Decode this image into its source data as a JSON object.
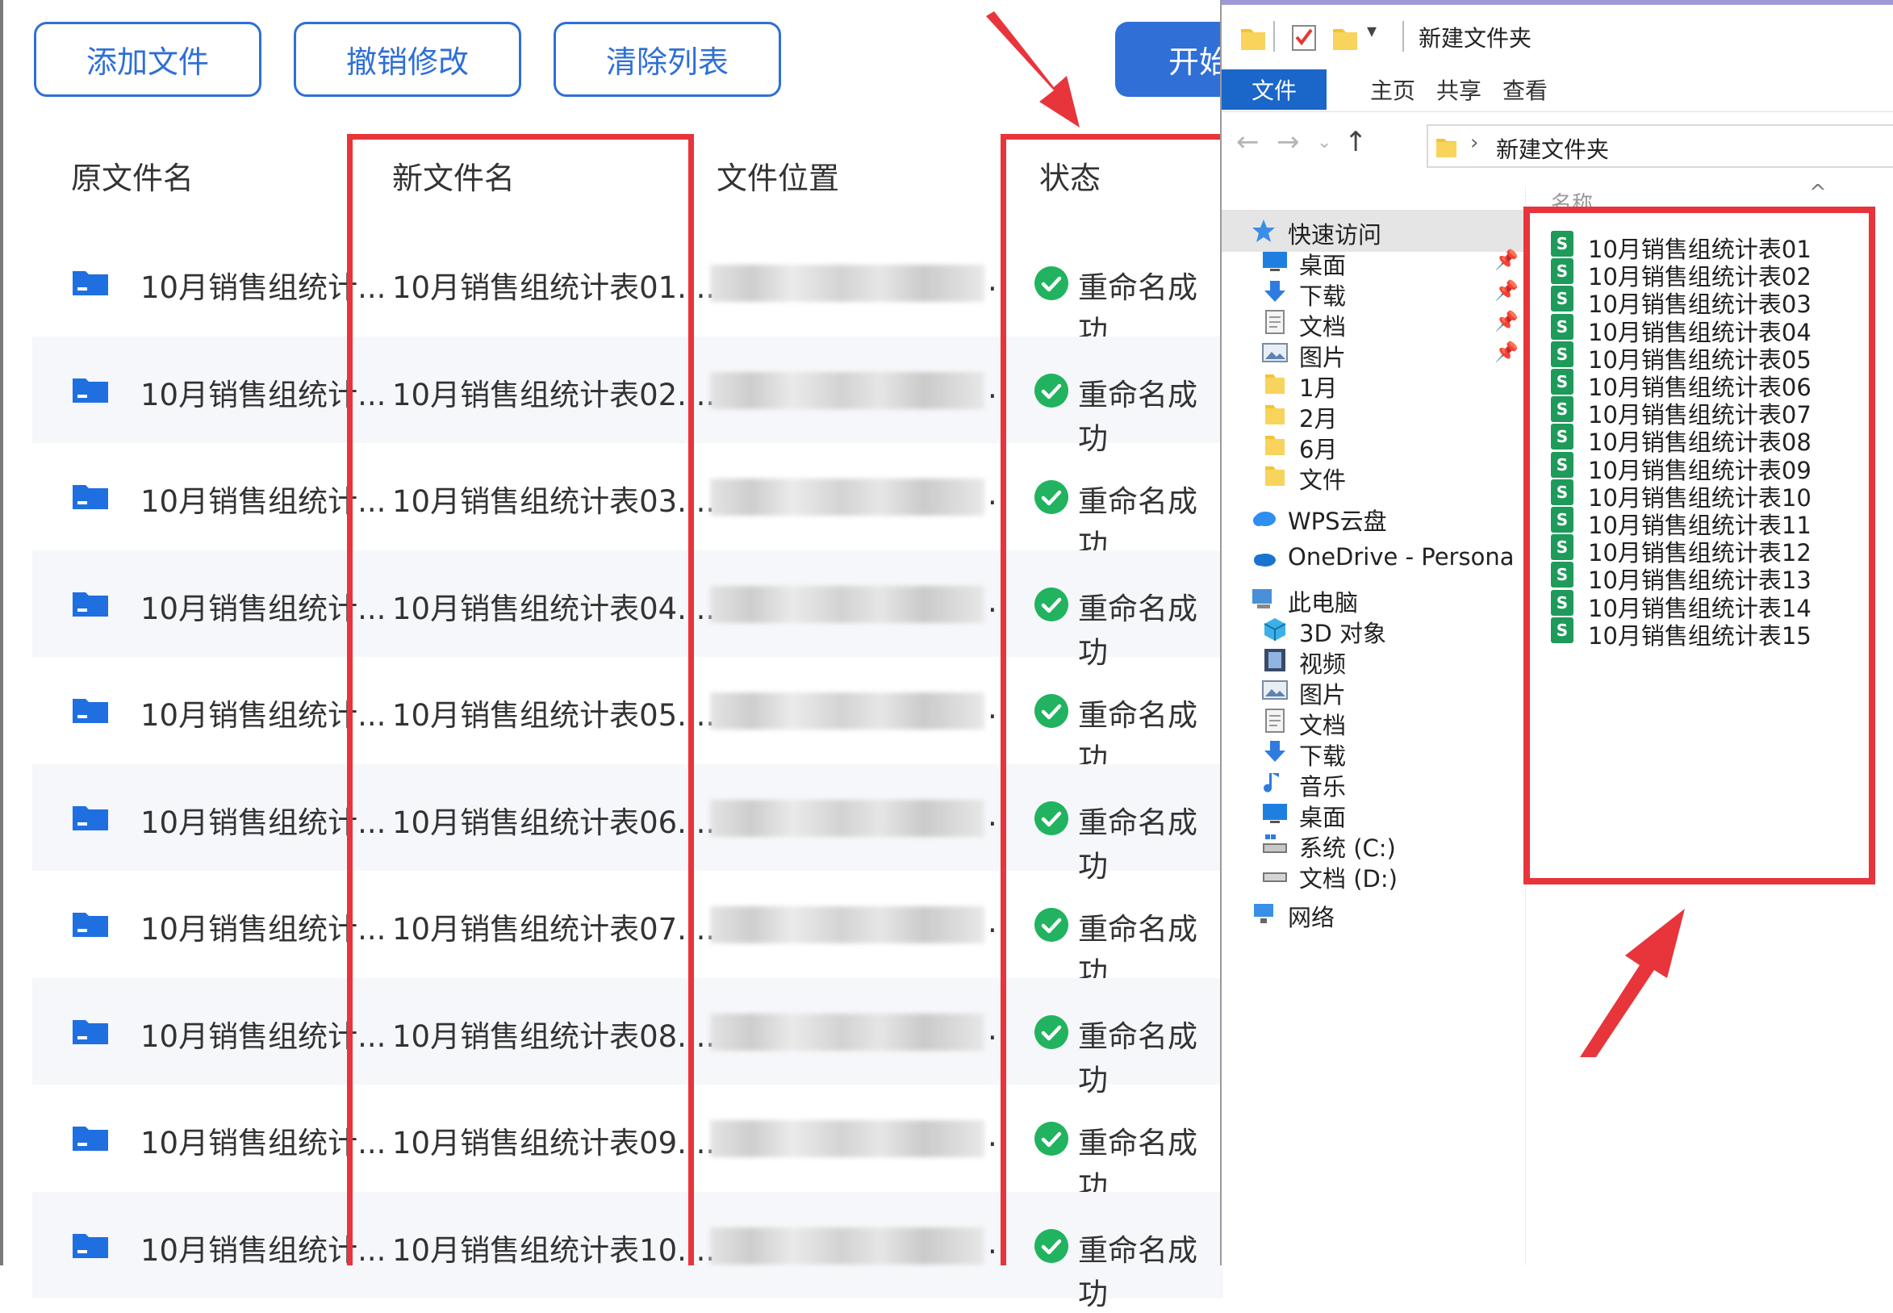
{
  "toolbar": {
    "add_label": "添加文件",
    "undo_label": "撤销修改",
    "clear_label": "清除列表",
    "start_label": "开始"
  },
  "table": {
    "headers": {
      "original": "原文件名",
      "new": "新文件名",
      "location": "文件位置",
      "status": "状态"
    },
    "rows": [
      {
        "original": "10月销售组统计...",
        "new": "10月销售组统计表01....",
        "location_suffix": ".",
        "status": "重命名成功"
      },
      {
        "original": "10月销售组统计...",
        "new": "10月销售组统计表02....",
        "location_suffix": ".",
        "status": "重命名成功"
      },
      {
        "original": "10月销售组统计...",
        "new": "10月销售组统计表03....",
        "location_suffix": ".",
        "status": "重命名成功"
      },
      {
        "original": "10月销售组统计...",
        "new": "10月销售组统计表04....",
        "location_suffix": ".",
        "status": "重命名成功"
      },
      {
        "original": "10月销售组统计...",
        "new": "10月销售组统计表05....",
        "location_suffix": ".",
        "status": "重命名成功"
      },
      {
        "original": "10月销售组统计...",
        "new": "10月销售组统计表06....",
        "location_suffix": ".",
        "status": "重命名成功"
      },
      {
        "original": "10月销售组统计...",
        "new": "10月销售组统计表07....",
        "location_suffix": ".",
        "status": "重命名成功"
      },
      {
        "original": "10月销售组统计...",
        "new": "10月销售组统计表08....",
        "location_suffix": ".",
        "status": "重命名成功"
      },
      {
        "original": "10月销售组统计...",
        "new": "10月销售组统计表09....",
        "location_suffix": ".",
        "status": "重命名成功"
      },
      {
        "original": "10月销售组统计...",
        "new": "10月销售组统计表10....",
        "location_suffix": ".",
        "status": "重命名成功"
      }
    ]
  },
  "explorer": {
    "title": "新建文件夹",
    "ribbon_tabs": [
      "文件",
      "主页",
      "共享",
      "查看"
    ],
    "breadcrumb": "新建文件夹",
    "column_name": "名称",
    "nav_items": [
      {
        "label": "快速访问",
        "icon": "star-icon",
        "pinned": false,
        "indent": 0
      },
      {
        "label": "桌面",
        "icon": "desktop-icon",
        "pinned": true,
        "indent": 1
      },
      {
        "label": "下载",
        "icon": "download-icon",
        "pinned": true,
        "indent": 1
      },
      {
        "label": "文档",
        "icon": "document-icon",
        "pinned": true,
        "indent": 1
      },
      {
        "label": "图片",
        "icon": "picture-icon",
        "pinned": true,
        "indent": 1
      },
      {
        "label": "1月",
        "icon": "folder-icon",
        "pinned": false,
        "indent": 1
      },
      {
        "label": "2月",
        "icon": "folder-icon",
        "pinned": false,
        "indent": 1
      },
      {
        "label": "6月",
        "icon": "folder-icon",
        "pinned": false,
        "indent": 1
      },
      {
        "label": "文件",
        "icon": "folder-icon",
        "pinned": false,
        "indent": 1
      },
      {
        "label": "WPS云盘",
        "icon": "cloud-icon",
        "pinned": false,
        "indent": 0
      },
      {
        "label": "OneDrive - Persona",
        "icon": "onedrive-icon",
        "pinned": false,
        "indent": 0
      },
      {
        "label": "此电脑",
        "icon": "computer-icon",
        "pinned": false,
        "indent": 0
      },
      {
        "label": "3D 对象",
        "icon": "cube-icon",
        "pinned": false,
        "indent": 1
      },
      {
        "label": "视频",
        "icon": "video-icon",
        "pinned": false,
        "indent": 1
      },
      {
        "label": "图片",
        "icon": "picture-icon",
        "pinned": false,
        "indent": 1
      },
      {
        "label": "文档",
        "icon": "document-icon",
        "pinned": false,
        "indent": 1
      },
      {
        "label": "下载",
        "icon": "download-icon",
        "pinned": false,
        "indent": 1
      },
      {
        "label": "音乐",
        "icon": "music-icon",
        "pinned": false,
        "indent": 1
      },
      {
        "label": "桌面",
        "icon": "desktop-icon",
        "pinned": false,
        "indent": 1
      },
      {
        "label": "系统 (C:)",
        "icon": "drive-c-icon",
        "pinned": false,
        "indent": 1
      },
      {
        "label": "文档 (D:)",
        "icon": "drive-icon",
        "pinned": false,
        "indent": 1
      },
      {
        "label": "网络",
        "icon": "network-icon",
        "pinned": false,
        "indent": 0
      }
    ],
    "files": [
      "10月销售组统计表01",
      "10月销售组统计表02",
      "10月销售组统计表03",
      "10月销售组统计表04",
      "10月销售组统计表05",
      "10月销售组统计表06",
      "10月销售组统计表07",
      "10月销售组统计表08",
      "10月销售组统计表09",
      "10月销售组统计表10",
      "10月销售组统计表11",
      "10月销售组统计表12",
      "10月销售组统计表13",
      "10月销售组统计表14",
      "10月销售组统计表15"
    ],
    "file_icon_letter": "S"
  },
  "colors": {
    "accent": "#2f6fd6",
    "success": "#21b35f",
    "highlight": "#e8343b",
    "ribbon_active": "#1a66c9"
  }
}
